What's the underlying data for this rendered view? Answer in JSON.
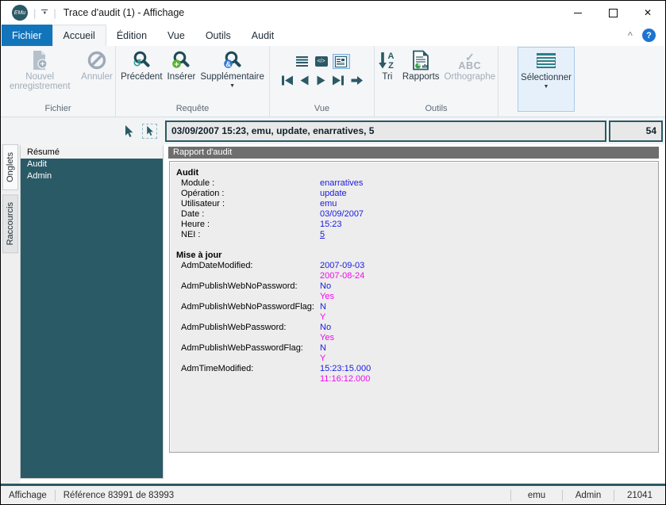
{
  "titlebar": {
    "title": "Trace d'audit (1) - Affichage",
    "app_logo_text": "EMu"
  },
  "tabs": [
    {
      "id": "fichier",
      "label": "Fichier",
      "file": true
    },
    {
      "id": "accueil",
      "label": "Accueil",
      "active": true
    },
    {
      "id": "edition",
      "label": "Édition"
    },
    {
      "id": "vue",
      "label": "Vue"
    },
    {
      "id": "outils",
      "label": "Outils"
    },
    {
      "id": "audit",
      "label": "Audit"
    }
  ],
  "ribbon": {
    "group_labels": {
      "file": "Fichier",
      "query": "Requête",
      "view": "Vue",
      "tools": "Outils"
    },
    "buttons": {
      "new_record": "Nouvel enregistrement",
      "cancel": "Annuler",
      "previous": "Précédent",
      "insert": "Insérer",
      "additional": "Supplémentaire",
      "sort": "Tri",
      "reports": "Rapports",
      "spelling": "Orthographe",
      "select": "Sélectionner"
    }
  },
  "icons": {
    "undo_glyph": "↺",
    "plus_glyph": "+",
    "amp_glyph": "&",
    "code_glyph": "</>",
    "check_glyph": "✓",
    "abc_glyph": "ABC",
    "sort_a": "A",
    "sort_z": "Z",
    "caret_down": "▼",
    "help_glyph": "?",
    "collapse_glyph": "^",
    "close_glyph": "✕",
    "qa_caret": "▼",
    "separator": "|"
  },
  "record_bar": {
    "summary": "03/09/2007 15:23, emu, update, enarratives, 5",
    "count": "54"
  },
  "sidebar": {
    "rail_tabs": [
      {
        "id": "onglets",
        "label": "Onglets",
        "active": true
      },
      {
        "id": "raccourcis",
        "label": "Raccourcis",
        "active": false
      }
    ],
    "items": [
      {
        "id": "resume",
        "label": "Résumé",
        "selected": true
      },
      {
        "id": "audit",
        "label": "Audit",
        "selected": false
      },
      {
        "id": "admin",
        "label": "Admin",
        "selected": false
      }
    ]
  },
  "report": {
    "header": "Rapport d'audit",
    "sections": [
      {
        "title": "Audit",
        "rows": [
          {
            "label": "Module :",
            "values": [
              {
                "text": "enarratives",
                "color": "blue"
              }
            ]
          },
          {
            "label": "Opération :",
            "values": [
              {
                "text": "update",
                "color": "blue"
              }
            ]
          },
          {
            "label": "Utilisateur :",
            "values": [
              {
                "text": "emu",
                "color": "blue"
              }
            ]
          },
          {
            "label": "Date :",
            "values": [
              {
                "text": "03/09/2007",
                "color": "blue"
              }
            ]
          },
          {
            "label": "Heure :",
            "values": [
              {
                "text": "15:23",
                "color": "blue"
              }
            ]
          },
          {
            "label": "NEI :",
            "values": [
              {
                "text": "5",
                "color": "blue",
                "link": true
              }
            ]
          }
        ]
      },
      {
        "title": "Mise à jour",
        "rows": [
          {
            "label": "AdmDateModified:",
            "values": [
              {
                "text": "2007-09-03",
                "color": "blue"
              },
              {
                "text": "2007-08-24",
                "color": "magenta"
              }
            ]
          },
          {
            "label": "AdmPublishWebNoPassword:",
            "values": [
              {
                "text": "No",
                "color": "blue"
              },
              {
                "text": "Yes",
                "color": "magenta"
              }
            ]
          },
          {
            "label": "AdmPublishWebNoPasswordFlag:",
            "values": [
              {
                "text": "N",
                "color": "blue"
              },
              {
                "text": "Y",
                "color": "magenta"
              }
            ]
          },
          {
            "label": "AdmPublishWebPassword:",
            "values": [
              {
                "text": "No",
                "color": "blue"
              },
              {
                "text": "Yes",
                "color": "magenta"
              }
            ]
          },
          {
            "label": "AdmPublishWebPasswordFlag:",
            "values": [
              {
                "text": "N",
                "color": "blue"
              },
              {
                "text": "Y",
                "color": "magenta"
              }
            ]
          },
          {
            "label": "AdmTimeModified:",
            "values": [
              {
                "text": "15:23:15.000",
                "color": "blue"
              },
              {
                "text": "11:16:12.000",
                "color": "magenta"
              }
            ]
          }
        ]
      }
    ]
  },
  "status_bar": {
    "left": [
      "Affichage",
      "Référence 83991 de 83993"
    ],
    "right": [
      "emu",
      "Admin",
      "21041"
    ]
  },
  "colors": {
    "blue": "#1A1AE0",
    "magenta": "#EE0AEE",
    "teal": "#2A5A66",
    "tab_blue": "#1275BC",
    "report_header_gray": "#6E6E6E"
  }
}
